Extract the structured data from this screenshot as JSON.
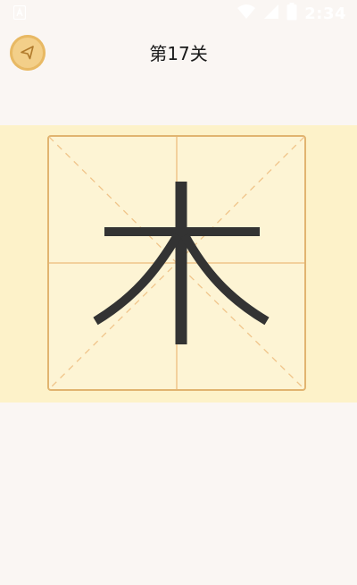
{
  "status_bar": {
    "time": "2:34",
    "app_icon": "a-letter-icon",
    "icons": [
      "wifi-icon",
      "signal-icon",
      "battery-icon"
    ]
  },
  "header": {
    "back_icon": "back-arrow-icon",
    "title": "第17关"
  },
  "practice": {
    "character": "木",
    "grid": "mi-zi-ge"
  },
  "colors": {
    "background": "#faf6f3",
    "band": "#fdf2c9",
    "grid_border": "#e1b470",
    "grid_lines": "#f0c48a",
    "stroke": "#333333",
    "back_button": "#f3cf89"
  }
}
